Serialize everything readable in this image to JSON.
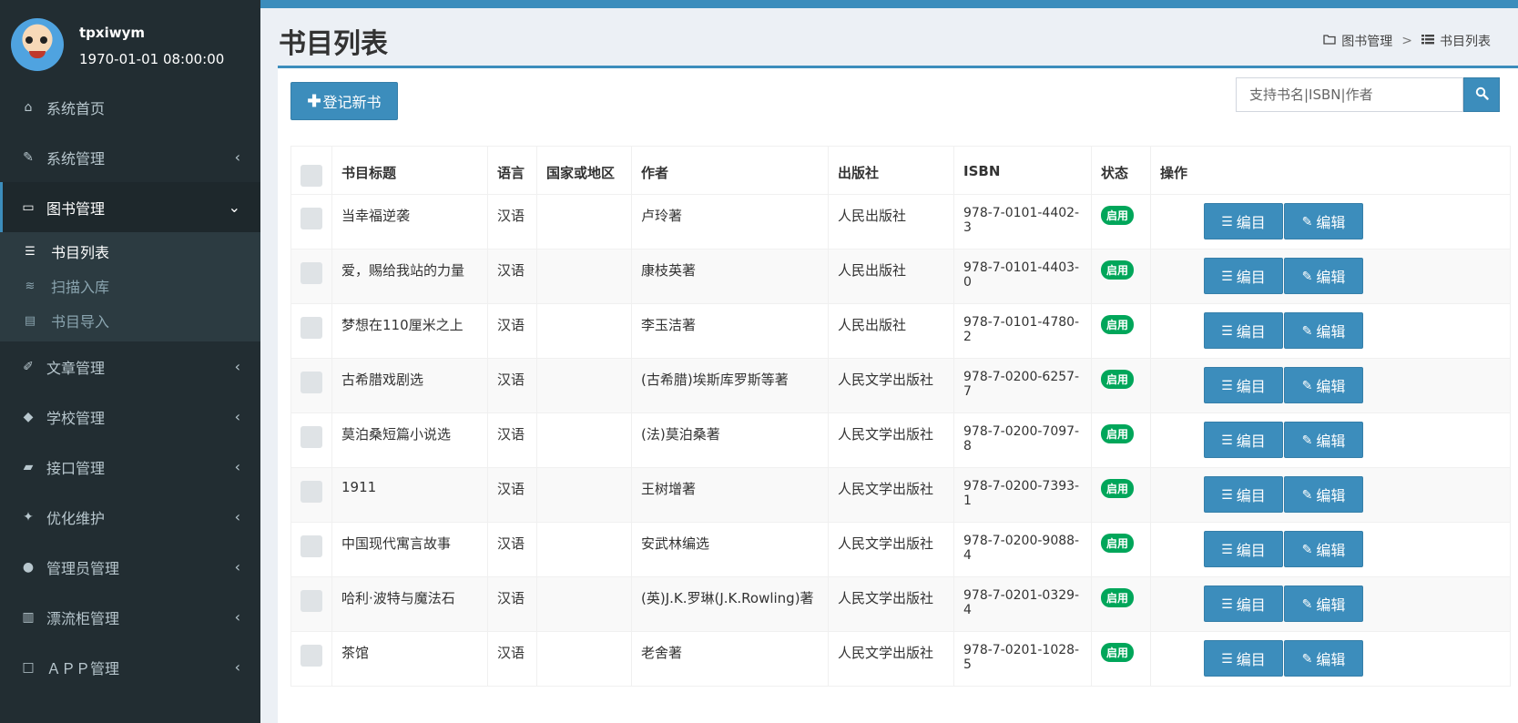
{
  "colors": {
    "sidebar_bg": "#222d32",
    "accent": "#3c8dbc",
    "status_green": "#00a65a"
  },
  "user": {
    "name": "tpxiwym",
    "time": "1970-01-01 08:00:00"
  },
  "sidebar": {
    "items": [
      {
        "label": "系统首页",
        "icon": "home-icon",
        "glyph": "⌂",
        "has_chevron": false
      },
      {
        "label": "系统管理",
        "icon": "wrench-icon",
        "glyph": "✎",
        "has_chevron": true
      },
      {
        "label": "图书管理",
        "icon": "folder-icon",
        "glyph": "▭",
        "has_chevron": true,
        "active": true
      },
      {
        "label": "文章管理",
        "icon": "edit-icon",
        "glyph": "✐",
        "has_chevron": true
      },
      {
        "label": "学校管理",
        "icon": "graduation-cap-icon",
        "glyph": "◆",
        "has_chevron": true
      },
      {
        "label": "接口管理",
        "icon": "book-icon",
        "glyph": "▰",
        "has_chevron": true
      },
      {
        "label": "优化维护",
        "icon": "gavel-icon",
        "glyph": "✦",
        "has_chevron": true
      },
      {
        "label": "管理员管理",
        "icon": "users-icon",
        "glyph": "●",
        "has_chevron": true
      },
      {
        "label": "漂流柜管理",
        "icon": "columns-icon",
        "glyph": "▥",
        "has_chevron": true
      },
      {
        "label": "ＡＰＰ管理",
        "icon": "square-icon",
        "glyph": "□",
        "has_chevron": true
      }
    ],
    "submenu": [
      {
        "label": "书目列表",
        "icon": "list-icon",
        "glyph": "☰",
        "active": true
      },
      {
        "label": "扫描入库",
        "icon": "barcode-icon",
        "glyph": "≋"
      },
      {
        "label": "书目导入",
        "icon": "open-book-icon",
        "glyph": "▤"
      }
    ]
  },
  "header": {
    "title": "书目列表",
    "breadcrumb": [
      {
        "label": "图书管理",
        "icon": "folder-icon"
      },
      {
        "label": "书目列表",
        "icon": "list-icon"
      }
    ],
    "breadcrumb_sep": ">"
  },
  "toolbar": {
    "add_label": "登记新书",
    "search_placeholder": "支持书名|ISBN|作者"
  },
  "table": {
    "columns": [
      "书目标题",
      "语言",
      "国家或地区",
      "作者",
      "出版社",
      "ISBN",
      "状态",
      "操作"
    ],
    "rows": [
      {
        "title": "当幸福逆袭",
        "lang": "汉语",
        "region": "",
        "author": "卢玲著",
        "publisher": "人民出版社",
        "isbn": "978-7-0101-4402-3",
        "status": "启用"
      },
      {
        "title": "爱，赐给我站的力量",
        "lang": "汉语",
        "region": "",
        "author": "康枝英著",
        "publisher": "人民出版社",
        "isbn": "978-7-0101-4403-0",
        "status": "启用"
      },
      {
        "title": "梦想在110厘米之上",
        "lang": "汉语",
        "region": "",
        "author": "李玉洁著",
        "publisher": "人民出版社",
        "isbn": "978-7-0101-4780-2",
        "status": "启用"
      },
      {
        "title": "古希腊戏剧选",
        "lang": "汉语",
        "region": "",
        "author": "(古希腊)埃斯库罗斯等著",
        "publisher": "人民文学出版社",
        "isbn": "978-7-0200-6257-7",
        "status": "启用"
      },
      {
        "title": "莫泊桑短篇小说选",
        "lang": "汉语",
        "region": "",
        "author": "(法)莫泊桑著",
        "publisher": "人民文学出版社",
        "isbn": "978-7-0200-7097-8",
        "status": "启用"
      },
      {
        "title": "1911",
        "lang": "汉语",
        "region": "",
        "author": "王树增著",
        "publisher": "人民文学出版社",
        "isbn": "978-7-0200-7393-1",
        "status": "启用"
      },
      {
        "title": "中国现代寓言故事",
        "lang": "汉语",
        "region": "",
        "author": "安武林编选",
        "publisher": "人民文学出版社",
        "isbn": "978-7-0200-9088-4",
        "status": "启用"
      },
      {
        "title": "哈利·波特与魔法石",
        "lang": "汉语",
        "region": "",
        "author": "(英)J.K.罗琳(J.K.Rowling)著",
        "publisher": "人民文学出版社",
        "isbn": "978-7-0201-0329-4",
        "status": "启用"
      },
      {
        "title": "茶馆",
        "lang": "汉语",
        "region": "",
        "author": "老舍著",
        "publisher": "人民文学出版社",
        "isbn": "978-7-0201-1028-5",
        "status": "启用"
      }
    ],
    "actions": {
      "catalog_label": "编目",
      "edit_label": "编辑"
    }
  }
}
